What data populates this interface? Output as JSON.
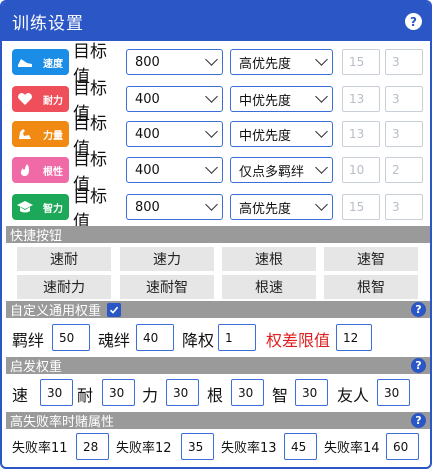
{
  "title": "训练设置",
  "help_glyph": "?",
  "colors": {
    "accent": "#2a56c6",
    "section_bg": "#9a9a9a",
    "warn_text": "#e02020"
  },
  "targets": [
    {
      "badge": "速度",
      "badge_color": "#1a8ee6",
      "icon": "shoe-icon",
      "label": "目标值",
      "value": "800",
      "priority": "高优先度",
      "a": "15",
      "b": "3"
    },
    {
      "badge": "耐力",
      "badge_color": "#ee4f5a",
      "icon": "heart-icon",
      "label": "目标值",
      "value": "400",
      "priority": "中优先度",
      "a": "13",
      "b": "3"
    },
    {
      "badge": "力量",
      "badge_color": "#f08a12",
      "icon": "flex-icon",
      "label": "目标值",
      "value": "400",
      "priority": "中优先度",
      "a": "13",
      "b": "3"
    },
    {
      "badge": "根性",
      "badge_color": "#f06aa7",
      "icon": "flame-icon",
      "label": "目标值",
      "value": "400",
      "priority": "仅点多羁绊",
      "a": "10",
      "b": "2"
    },
    {
      "badge": "智力",
      "badge_color": "#1ca858",
      "icon": "grad-cap-icon",
      "label": "目标值",
      "value": "800",
      "priority": "高优先度",
      "a": "15",
      "b": "3"
    }
  ],
  "quick": {
    "title": "快捷按钮",
    "buttons": [
      "速耐",
      "速力",
      "速根",
      "速智",
      "速耐力",
      "速耐智",
      "根速",
      "根智"
    ]
  },
  "custom_weight": {
    "title": "自定义通用权重",
    "checked": true,
    "bond_label": "羁绊",
    "bond_value": "50",
    "soul_label": "魂绊",
    "soul_value": "40",
    "reduce_label": "降权",
    "reduce_value": "1",
    "diff_label": "权差限值",
    "diff_value": "12"
  },
  "heuristic": {
    "title": "启发权重",
    "items": [
      {
        "label": "速",
        "value": "30"
      },
      {
        "label": "耐",
        "value": "30"
      },
      {
        "label": "力",
        "value": "30"
      },
      {
        "label": "根",
        "value": "30"
      },
      {
        "label": "智",
        "value": "30"
      },
      {
        "label": "友人",
        "value": "30"
      }
    ]
  },
  "fail": {
    "title": "高失败率时赌属性",
    "items": [
      {
        "label": "失败率11",
        "value": "28"
      },
      {
        "label": "失败率12",
        "value": "35"
      },
      {
        "label": "失败率13",
        "value": "45"
      },
      {
        "label": "失败率14",
        "value": "60"
      }
    ]
  }
}
